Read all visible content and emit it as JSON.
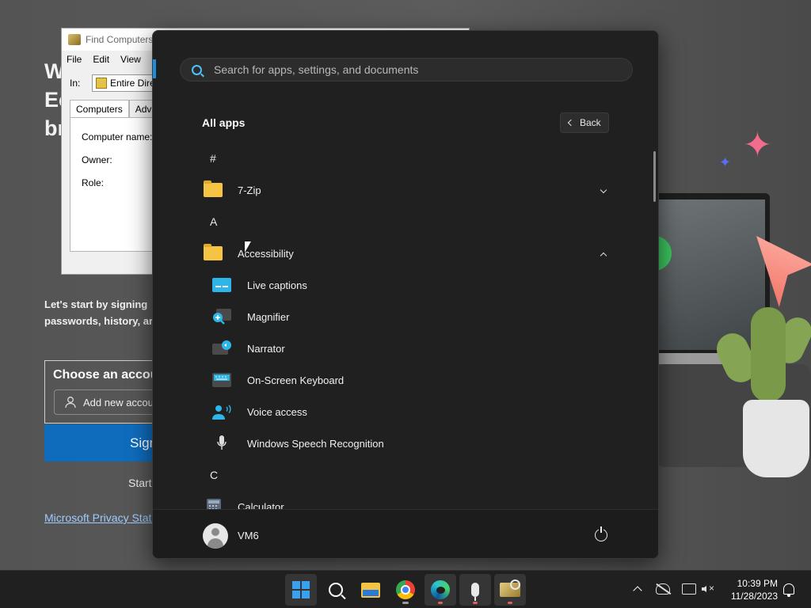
{
  "background": {
    "heading_lines": [
      "W",
      "Ec",
      "br"
    ],
    "sub_lines": [
      "Let's start by signing",
      "passwords, history, ar"
    ],
    "choose_account": "Choose an accou",
    "add_account": "Add new accoun",
    "sign_button": "Sign",
    "start_button": "Start",
    "privacy_link": "Microsoft Privacy State"
  },
  "find_dialog": {
    "title": "Find Computers",
    "menu": [
      "File",
      "Edit",
      "View"
    ],
    "in_label": "In:",
    "in_value": "Entire Direc",
    "tabs": [
      "Computers",
      "Advanc"
    ],
    "fields": [
      "Computer name:",
      "Owner:",
      "Role:"
    ]
  },
  "start_menu": {
    "search_placeholder": "Search for apps, settings, and documents",
    "all_apps_title": "All apps",
    "back_label": "Back",
    "letters": [
      "#",
      "A",
      "C"
    ],
    "apps": {
      "seven_zip": "7-Zip",
      "accessibility": "Accessibility",
      "live_captions": "Live captions",
      "magnifier": "Magnifier",
      "narrator": "Narrator",
      "osk": "On-Screen Keyboard",
      "voice_access": "Voice access",
      "speech_recognition": "Windows Speech Recognition",
      "calculator": "Calculator"
    },
    "user_name": "VM6"
  },
  "taskbar": {
    "time": "10:39 PM",
    "date": "11/28/2023",
    "pinned": [
      "start",
      "search",
      "file-explorer",
      "chrome",
      "edge",
      "speech-recognition",
      "find-computers"
    ]
  },
  "colors": {
    "accent": "#4cc2ff",
    "start_bg": "#202020",
    "edge_blue": "#0f6cbd"
  }
}
